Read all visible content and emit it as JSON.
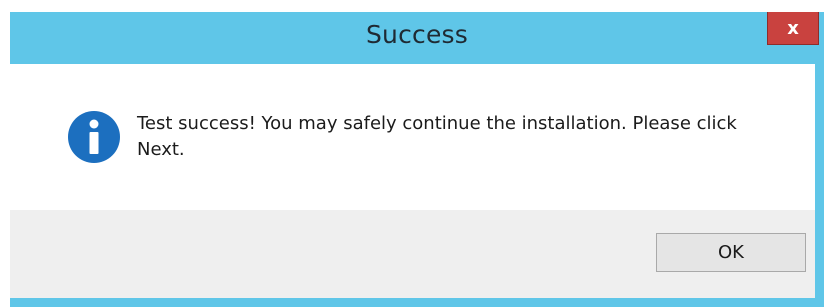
{
  "window": {
    "title": "Success",
    "close_label": "x"
  },
  "content": {
    "icon": "info-icon",
    "message": "Test success!  You may safely continue the installation. Please click Next."
  },
  "footer": {
    "ok_label": "OK"
  },
  "colors": {
    "titlebar": "#5fc6e8",
    "close_button": "#c9423f",
    "info_icon": "#1c6fbf",
    "footer": "#efefef"
  }
}
